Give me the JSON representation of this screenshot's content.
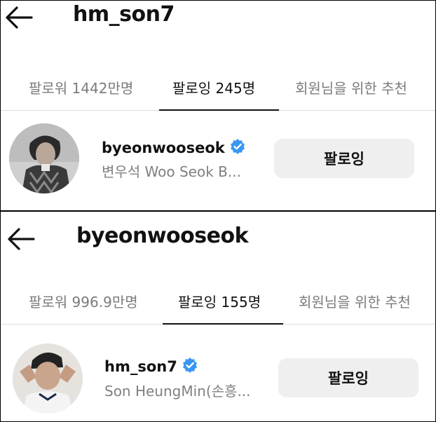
{
  "screen1": {
    "title": "hm_son7",
    "tabs": [
      {
        "label": "팔로워 1442만명",
        "active": false
      },
      {
        "label": "팔로잉 245명",
        "active": true
      },
      {
        "label": "회원님을 위한 추천",
        "active": false
      }
    ],
    "account": {
      "username": "byeonwooseok",
      "verified": true,
      "subtitle": "변우석  Woo Seok B...",
      "button_label": "팔로잉"
    }
  },
  "screen2": {
    "title": "byeonwooseok",
    "tabs": [
      {
        "label": "팔로워 996.9만명",
        "active": false
      },
      {
        "label": "팔로잉 155명",
        "active": true
      },
      {
        "label": "회원님을 위한 추천",
        "active": false
      }
    ],
    "account": {
      "username": "hm_son7",
      "verified": true,
      "subtitle": "Son HeungMin(손흥...",
      "button_label": "팔로잉"
    }
  },
  "colors": {
    "verified_badge": "#3897f0",
    "button_bg": "#efefef",
    "inactive_tab_text": "#7b7b7b",
    "subtitle_text": "#808080"
  },
  "icons": [
    "back-arrow-icon",
    "verified-badge-icon"
  ]
}
